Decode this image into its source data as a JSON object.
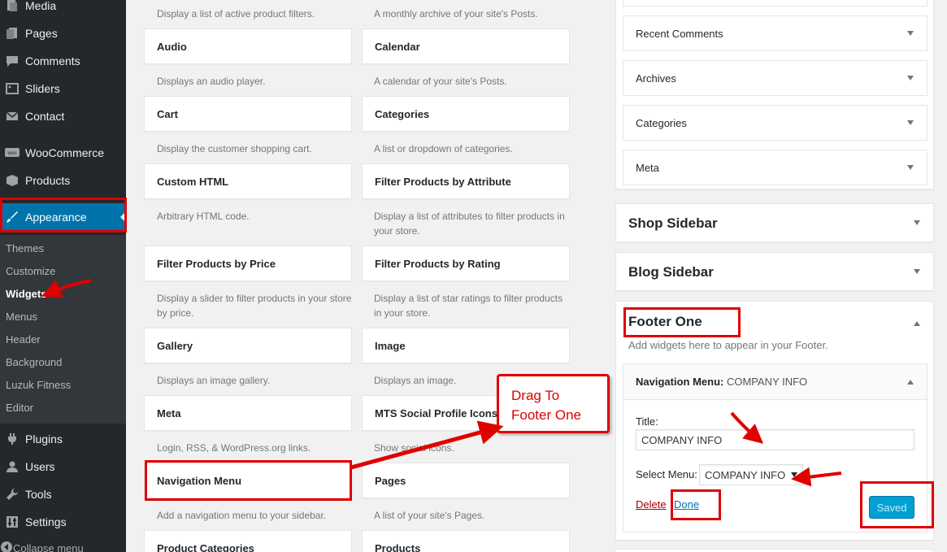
{
  "admin_menu": {
    "items": [
      {
        "label": "Media",
        "icon": "media-icon"
      },
      {
        "label": "Pages",
        "icon": "pages-icon"
      },
      {
        "label": "Comments",
        "icon": "comments-icon"
      },
      {
        "label": "Sliders",
        "icon": "sliders-icon"
      },
      {
        "label": "Contact",
        "icon": "contact-icon"
      },
      {
        "label": "WooCommerce",
        "icon": "woocommerce-icon"
      },
      {
        "label": "Products",
        "icon": "products-icon"
      },
      {
        "label": "Appearance",
        "icon": "appearance-icon"
      },
      {
        "label": "Plugins",
        "icon": "plugins-icon"
      },
      {
        "label": "Users",
        "icon": "users-icon"
      },
      {
        "label": "Tools",
        "icon": "tools-icon"
      },
      {
        "label": "Settings",
        "icon": "settings-icon"
      }
    ],
    "submenu": [
      "Themes",
      "Customize",
      "Widgets",
      "Menus",
      "Header",
      "Background",
      "Luzuk Fitness",
      "Editor"
    ],
    "collapse": "Collapse menu"
  },
  "available_widgets": {
    "top_descriptions": [
      "Display a list of active product filters.",
      "A monthly archive of your site's Posts."
    ],
    "items": [
      {
        "title": "Audio",
        "desc": "Displays an audio player."
      },
      {
        "title": "Calendar",
        "desc": "A calendar of your site's Posts."
      },
      {
        "title": "Cart",
        "desc": "Display the customer shopping cart."
      },
      {
        "title": "Categories",
        "desc": "A list or dropdown of categories."
      },
      {
        "title": "Custom HTML",
        "desc": "Arbitrary HTML code."
      },
      {
        "title": "Filter Products by Attribute",
        "desc": "Display a list of attributes to filter products in your store."
      },
      {
        "title": "Filter Products by Price",
        "desc": "Display a slider to filter products in your store by price."
      },
      {
        "title": "Filter Products by Rating",
        "desc": "Display a list of star ratings to filter products in your store."
      },
      {
        "title": "Gallery",
        "desc": "Displays an image gallery."
      },
      {
        "title": "Image",
        "desc": "Displays an image."
      },
      {
        "title": "Meta",
        "desc": "Login, RSS, & WordPress.org links."
      },
      {
        "title": "MTS Social Profile Icons",
        "desc": "Show social icons."
      },
      {
        "title": "Navigation Menu",
        "desc": "Add a navigation menu to your sidebar."
      },
      {
        "title": "Pages",
        "desc": "A list of your site's Pages."
      },
      {
        "title": "Product Categories",
        "desc": ""
      },
      {
        "title": "Products",
        "desc": ""
      }
    ]
  },
  "main_sidebar_widgets": [
    "Recent Comments",
    "Archives",
    "Categories",
    "Meta"
  ],
  "shop_sidebar": {
    "title": "Shop Sidebar"
  },
  "blog_sidebar": {
    "title": "Blog Sidebar"
  },
  "footer_one": {
    "title": "Footer One",
    "description": "Add widgets here to appear in your Footer.",
    "widget": {
      "type": "Navigation Menu:",
      "instance": "COMPANY INFO",
      "title_label": "Title:",
      "title_value": "COMPANY INFO",
      "menu_label": "Select Menu:",
      "menu_value": "COMPANY INFO",
      "delete": "Delete",
      "separator": "|",
      "done": "Done",
      "saved": "Saved"
    }
  },
  "annotation": {
    "callout_line1": "Drag To",
    "callout_line2": "Footer One"
  },
  "colors": {
    "admin_bg": "#23282d",
    "submenu_bg": "#32373c",
    "active_blue": "#0073aa",
    "annotation_red": "#e00000",
    "saved_button": "#00a0d2"
  }
}
